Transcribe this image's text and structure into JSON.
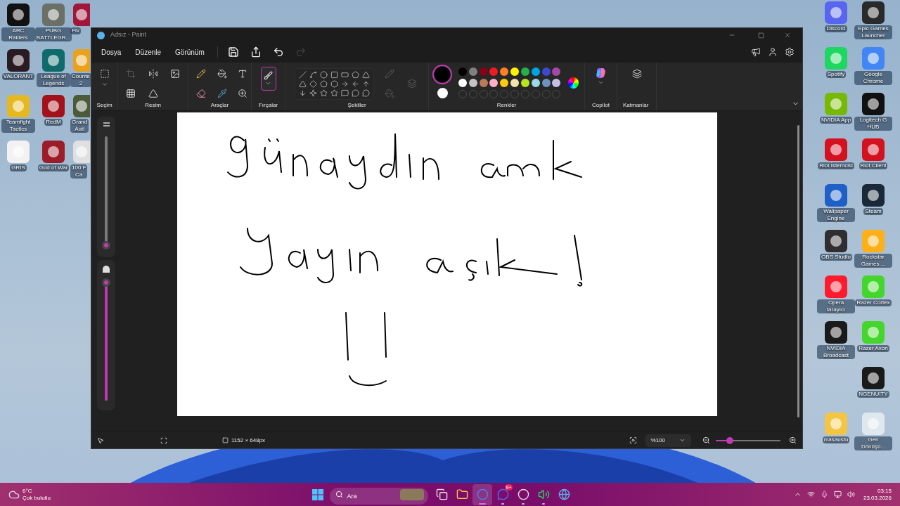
{
  "desktop": {
    "left_icons": [
      {
        "label": "ARC Raiders",
        "color": "#111111"
      },
      {
        "label": "PUBG BATTLEGR...",
        "color": "#6b6f66"
      },
      {
        "label": "Fiv",
        "color": "#a0173a"
      },
      {
        "label": "VALORANT",
        "color": "#2a1a22"
      },
      {
        "label": "League of Legends",
        "color": "#0f6b6b"
      },
      {
        "label": "Counte\n2",
        "color": "#e8a21e"
      },
      {
        "label": "Teamfight Tactics",
        "color": "#e6b820"
      },
      {
        "label": "RedM",
        "color": "#a3121a"
      },
      {
        "label": "Grand\nAuti",
        "color": "#4c5a3a"
      },
      {
        "label": "GRIS",
        "color": "#f2f2f2"
      },
      {
        "label": "God of War",
        "color": "#9c1c28"
      },
      {
        "label": "100 F\nCa",
        "color": "#e0e0e0"
      }
    ],
    "right_icons": [
      {
        "label": "Discord",
        "color": "#5865f2"
      },
      {
        "label": "Epic Games Launcher",
        "color": "#2a2a2a"
      },
      {
        "label": "Spotify",
        "color": "#1ed760"
      },
      {
        "label": "Google Chrome",
        "color": "#4285f4"
      },
      {
        "label": "NVIDIA App",
        "color": "#76b900"
      },
      {
        "label": "Logitech G HUB",
        "color": "#111111"
      },
      {
        "label": "Riot İstemcisi",
        "color": "#d4111e"
      },
      {
        "label": "Riot Client",
        "color": "#d4111e"
      },
      {
        "label": "Wallpaper Engine",
        "color": "#1f5fc8"
      },
      {
        "label": "Steam",
        "color": "#1b2838"
      },
      {
        "label": "OBS Studio",
        "color": "#302e31"
      },
      {
        "label": "Rockstar Games ...",
        "color": "#fcaf17"
      },
      {
        "label": "Opera tarayıcı",
        "color": "#ff1b2d"
      },
      {
        "label": "Razer Cortex",
        "color": "#44d62c"
      },
      {
        "label": "NVIDIA Broadcast",
        "color": "#1a1a1a"
      },
      {
        "label": "Razer Axon",
        "color": "#44d62c"
      },
      {
        "label": "NGENUITY",
        "color": "#1a1a1a"
      },
      {
        "label": "masaustu",
        "color": "#f4c542"
      },
      {
        "label": "Geri Dönüşü...",
        "color": "#dfe8ef"
      }
    ]
  },
  "window": {
    "title": "Adsız - Paint",
    "menu": [
      "Dosya",
      "Düzenle",
      "Görünüm"
    ],
    "quick_actions": [
      {
        "kind": "save",
        "disabled": false
      },
      {
        "kind": "share",
        "disabled": false
      },
      {
        "kind": "undo",
        "disabled": false
      },
      {
        "kind": "redo",
        "disabled": true
      }
    ],
    "ribbon_groups": [
      {
        "kind": "selection",
        "label": "Seçim"
      },
      {
        "kind": "image",
        "label": "Resim"
      },
      {
        "kind": "tools",
        "label": "Araçlar"
      },
      {
        "kind": "brushes",
        "label": "Fırçalar"
      },
      {
        "kind": "shapes",
        "label": "Şekiller"
      },
      {
        "kind": "colors",
        "label": "Renkler"
      },
      {
        "kind": "copilot",
        "label": "Copilot"
      },
      {
        "kind": "layers",
        "label": "Katmanlar"
      }
    ],
    "brush_tool": {
      "selected": true
    },
    "primary_color": {
      "color": "#000000",
      "selected": true
    },
    "secondary_color": {
      "color": "#ffffff",
      "selected": false
    },
    "palette": [
      {
        "color": "#000000"
      },
      {
        "color": "#7f7f7f"
      },
      {
        "color": "#880015"
      },
      {
        "color": "#ed1c24"
      },
      {
        "color": "#ff7f27"
      },
      {
        "color": "#fff200"
      },
      {
        "color": "#22b14c"
      },
      {
        "color": "#00a2e8"
      },
      {
        "color": "#3f48cc"
      },
      {
        "color": "#a349a4"
      },
      {
        "color": "#ffffff"
      },
      {
        "color": "#c3c3c3"
      },
      {
        "color": "#b97a57"
      },
      {
        "color": "#ffaec9"
      },
      {
        "color": "#ffc90e"
      },
      {
        "color": "#efe4b0"
      },
      {
        "color": "#b5e61d"
      },
      {
        "color": "#99d9ea"
      },
      {
        "color": "#7092be"
      },
      {
        "color": "#c8bfe7"
      }
    ],
    "brush_size": {
      "level": 0.02
    },
    "opacity": {
      "level": 1
    },
    "status_bar": {
      "canvas_size": "1152 × 648px",
      "zoom": "%100",
      "zoom_slider": {
        "level": 0.18
      }
    }
  },
  "taskbar": {
    "weather": {
      "temperature": "6°C",
      "condition": "Çok bulutlu"
    },
    "search_placeholder": "Ara",
    "apps": [
      {
        "kind": "taskview",
        "selected": false,
        "running": false
      },
      {
        "kind": "explorer",
        "selected": false,
        "running": false
      },
      {
        "kind": "chrome",
        "selected": true,
        "running": true
      },
      {
        "kind": "discord",
        "selected": false,
        "running": true,
        "badge": "9+"
      },
      {
        "kind": "obs",
        "selected": false,
        "running": true
      },
      {
        "kind": "spotify",
        "selected": false,
        "running": true
      },
      {
        "kind": "globe",
        "selected": false,
        "running": false
      }
    ],
    "time": "03:15",
    "date": "23.03.2026"
  }
}
